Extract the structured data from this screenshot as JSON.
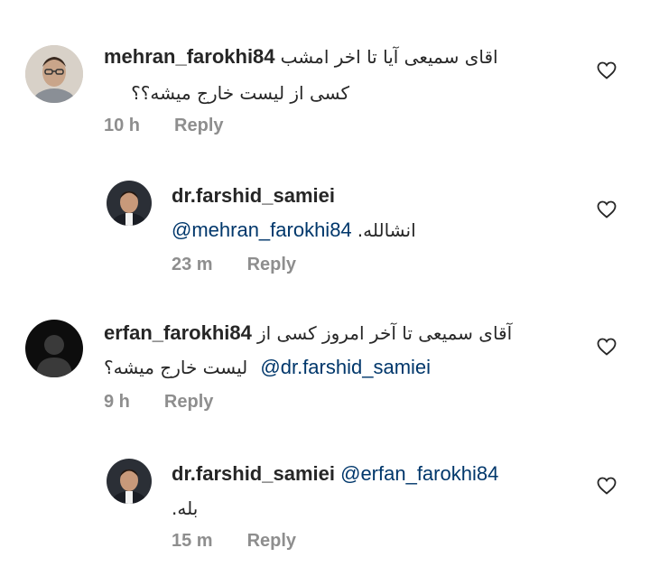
{
  "comments": [
    {
      "username": "mehran_farokhi84",
      "text_line1": "اقای سمیعی آیا تا اخر امشب",
      "text_line2": "کسی از لیست خارج میشه؟؟",
      "time": "10 h",
      "reply_label": "Reply"
    },
    {
      "username": "dr.farshid_samiei",
      "mention": "@mehran_farokhi84",
      "text": "انشالله.",
      "time": "23 m",
      "reply_label": "Reply"
    },
    {
      "username": "erfan_farokhi84",
      "text_line1": "آقای سمیعی تا آخر امروز کسی از",
      "text_line2": "لیست خارج میشه؟",
      "mention": "@dr.farshid_samiei",
      "time": "9 h",
      "reply_label": "Reply"
    },
    {
      "username": "dr.farshid_samiei",
      "mention": "@erfan_farokhi84",
      "text": "بله.",
      "time": "15 m",
      "reply_label": "Reply"
    }
  ],
  "icons": {
    "like": "heart-outline-icon"
  },
  "colors": {
    "mention": "#00376b",
    "meta": "#8e8e8e"
  }
}
